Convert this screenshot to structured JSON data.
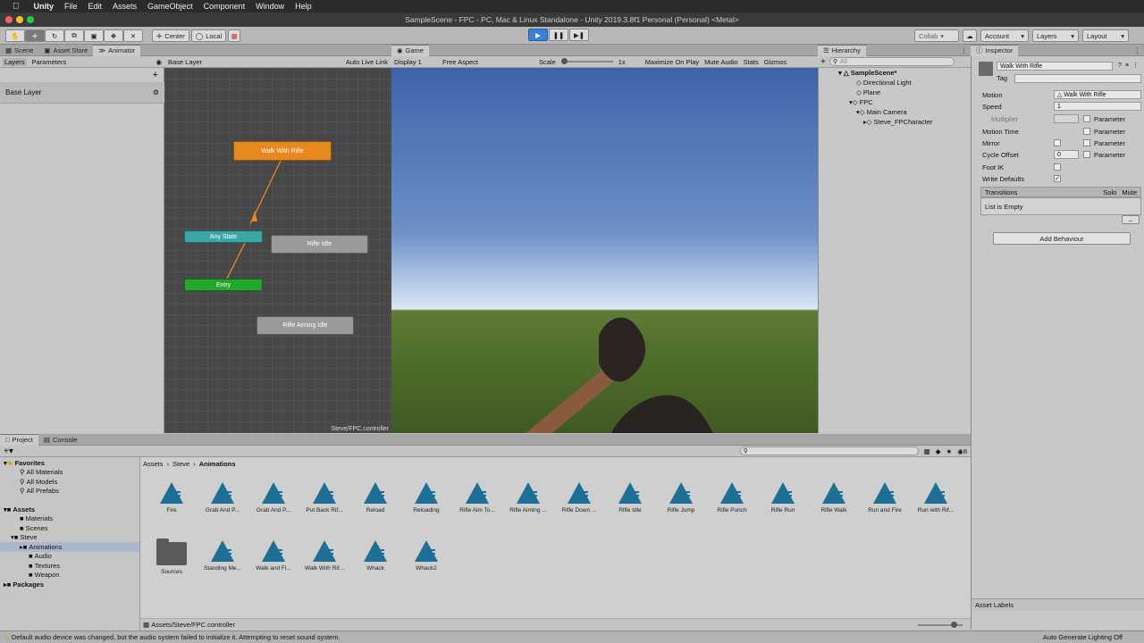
{
  "menubar": {
    "items": [
      "Unity",
      "File",
      "Edit",
      "Assets",
      "GameObject",
      "Component",
      "Window",
      "Help"
    ]
  },
  "titlebar": {
    "title": "SampleScene - FPC - PC, Mac & Linux Standalone - Unity 2019.3.8f1 Personal (Personal) <Metal>"
  },
  "toolbar": {
    "center": "Center",
    "local": "Local",
    "collab": "Collab",
    "account": "Account",
    "layers": "Layers",
    "layout": "Layout"
  },
  "scene_tabs": {
    "scene": "Scene",
    "asset_store": "Asset Store",
    "animator": "Animator"
  },
  "animator": {
    "layers_tab": "Layers",
    "parameters_tab": "Parameters",
    "breadcrumb": "Base Layer",
    "auto_live": "Auto Live Link",
    "base_layer": "Base Layer",
    "footer": "Steve/FPC.controller",
    "states": {
      "walk": "Walk With Rifle",
      "any": "Any State",
      "idle": "Rifle Idle",
      "entry": "Entry",
      "aiming": "Rifle Aiming Idle"
    }
  },
  "game": {
    "tab": "Game",
    "display": "Display 1",
    "aspect": "Free Aspect",
    "scale": "Scale",
    "scale_value": "1x",
    "maximize": "Maximize On Play",
    "mute": "Mute Audio",
    "stats": "Stats",
    "gizmos": "Gizmos"
  },
  "hierarchy": {
    "tab": "Hierarchy",
    "search": "All",
    "scene": "SampleScene*",
    "items": [
      "Directional Light",
      "Plane",
      "FPC",
      "Main Camera",
      "Steve_FPCharacter"
    ]
  },
  "inspector": {
    "tab": "Inspector",
    "name": "Walk With Rifle",
    "tag": "Tag",
    "motion_label": "Motion",
    "motion_value": "Walk With Rifle",
    "speed_label": "Speed",
    "speed_value": "1",
    "multiplier": "Multiplier",
    "parameter": "Parameter",
    "motion_time": "Motion Time",
    "mirror": "Mirror",
    "cycle_offset": "Cycle Offset",
    "cycle_value": "0",
    "foot_ik": "Foot IK",
    "write_defaults": "Write Defaults",
    "transitions": "Transitions",
    "solo": "Solo",
    "mute": "Mute",
    "list_empty": "List is Empty",
    "add_behaviour": "Add Behaviour",
    "asset_labels": "Asset Labels",
    "auto_lighting": "Auto Generate Lighting Off"
  },
  "project": {
    "tab_project": "Project",
    "tab_console": "Console",
    "breadcrumb": [
      "Assets",
      "Steve",
      "Animations"
    ],
    "favorites": "Favorites",
    "fav_items": [
      "All Materials",
      "All Models",
      "All Prefabs"
    ],
    "assets_root": "Assets",
    "tree": [
      "Materials",
      "Scenes",
      "Steve",
      "Animations",
      "Audio",
      "Textures",
      "Weapon"
    ],
    "packages": "Packages",
    "row1": [
      "Fire",
      "Grab And P...",
      "Grab And P...",
      "Put Back Rif...",
      "Reload",
      "Reloading",
      "Rifle Aim To...",
      "Rifle Aiming ...",
      "Rifle Down ...",
      "Rifle Idle",
      "Rifle Jump",
      "Rifle Punch",
      "Rifle Run",
      "Rifle Walk",
      "Run and Fire",
      "Run with Rif..."
    ],
    "row2": [
      "Sources",
      "Standing Me...",
      "Walk and Fi...",
      "Walk With Rif...",
      "Whack",
      "Whack2"
    ],
    "path": "Assets/Steve/FPC.controller",
    "count": "8"
  },
  "status": {
    "message": "Default audio device was changed, but the audio system failed to initialize it. Attempting to reset sound system."
  },
  "colors": {
    "walk": "#e8891e",
    "any": "#3aa6a6",
    "entry": "#23a62c",
    "grey_state": "#9a9a9a",
    "asset_icon": "#1d6f96"
  }
}
